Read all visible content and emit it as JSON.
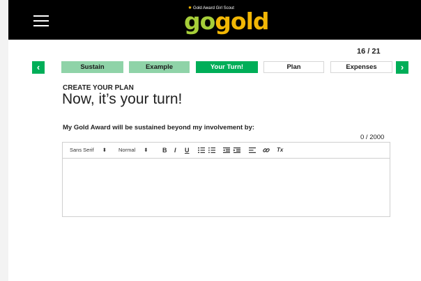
{
  "header": {
    "logo_tagline": "Gold Award Girl Scout",
    "logo_go": "go",
    "logo_gold": "gold",
    "menu_icon": "hamburger-menu-icon"
  },
  "progress": {
    "counter": "16 / 21",
    "current": 16,
    "total": 21
  },
  "nav": {
    "prev_icon": "chevron-left-icon",
    "next_icon": "chevron-right-icon",
    "prev_symbol": "‹",
    "next_symbol": "›",
    "steps": [
      {
        "label": "Sustain",
        "state": "done"
      },
      {
        "label": "Example",
        "state": "done"
      },
      {
        "label": "Your Turn!",
        "state": "active"
      },
      {
        "label": "Plan",
        "state": "todo"
      },
      {
        "label": "Expenses",
        "state": "todo"
      }
    ]
  },
  "content": {
    "eyebrow": "CREATE YOUR PLAN",
    "heading": "Now, it’s your turn!",
    "question": "My Gold Award will be sustained beyond my involvement by:",
    "char_count": "0 / 2000",
    "char_max": 2000
  },
  "editor": {
    "font_select": "Sans Serif",
    "size_select": "Normal",
    "bold": "B",
    "italic": "I",
    "underline": "U",
    "clear_format": "Tx",
    "text_value": ""
  },
  "colors": {
    "accent_green": "#00ae58",
    "light_green": "#8fd3a8",
    "logo_go": "#a6ce39",
    "logo_gold": "#f2b705"
  }
}
